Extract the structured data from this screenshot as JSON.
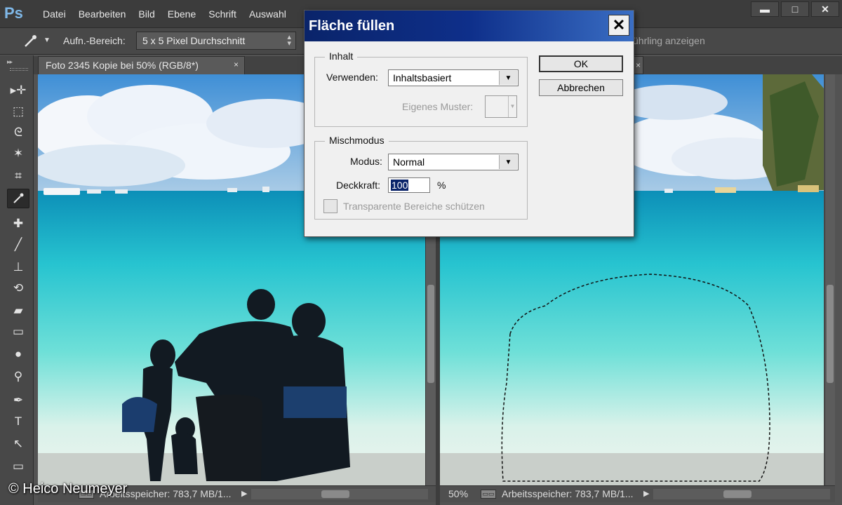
{
  "app": {
    "logo": "Ps"
  },
  "menu": [
    "Datei",
    "Bearbeiten",
    "Bild",
    "Ebene",
    "Schrift",
    "Auswahl"
  ],
  "window_controls": {
    "minimize": "▬",
    "maximize": "□",
    "close": "✕"
  },
  "options_bar": {
    "sample_label": "Aufn.-Bereich:",
    "sample_value": "5 x 5 Pixel Durchschnitt",
    "sample_ring_text": "ührling anzeigen"
  },
  "tools": [
    {
      "name": "move-tool-icon",
      "glyph": "▸✛"
    },
    {
      "name": "marquee-tool-icon",
      "glyph": "⬚"
    },
    {
      "name": "lasso-tool-icon",
      "glyph": "ᘓ"
    },
    {
      "name": "magic-wand-tool-icon",
      "glyph": "✶"
    },
    {
      "name": "crop-tool-icon",
      "glyph": "⌗"
    },
    {
      "name": "eyedropper-tool-icon",
      "glyph": "⁄",
      "active": true
    },
    {
      "name": "healing-brush-tool-icon",
      "glyph": "✚"
    },
    {
      "name": "brush-tool-icon",
      "glyph": "╱"
    },
    {
      "name": "stamp-tool-icon",
      "glyph": "⊥"
    },
    {
      "name": "history-brush-tool-icon",
      "glyph": "⟲"
    },
    {
      "name": "eraser-tool-icon",
      "glyph": "▰"
    },
    {
      "name": "gradient-tool-icon",
      "glyph": "▭"
    },
    {
      "name": "blur-tool-icon",
      "glyph": "●"
    },
    {
      "name": "dodge-tool-icon",
      "glyph": "⚲"
    },
    {
      "name": "pen-tool-icon",
      "glyph": "✒"
    },
    {
      "name": "type-tool-icon",
      "glyph": "T"
    },
    {
      "name": "path-select-tool-icon",
      "glyph": "↖"
    },
    {
      "name": "shape-tool-icon",
      "glyph": "▭"
    }
  ],
  "document": {
    "tab_title": "Foto 2345 Kopie bei 50% (RGB/8*)",
    "tab_close": "×",
    "tab2_close": "×"
  },
  "status_left": {
    "mem": "Arbeitsspeicher: 783,7 MB/1...",
    "arrow": "▶"
  },
  "status_right": {
    "zoom": "50%",
    "mem": "Arbeitsspeicher: 783,7 MB/1...",
    "arrow": "▶"
  },
  "copyright": "© Heico Neumeyer",
  "dialog": {
    "title": "Fläche füllen",
    "close": "✕",
    "content_group": "Inhalt",
    "use_label": "Verwenden:",
    "use_value": "Inhaltsbasiert",
    "custom_pattern_label": "Eigenes Muster:",
    "blend_group": "Mischmodus",
    "mode_label": "Modus:",
    "mode_value": "Normal",
    "opacity_label": "Deckkraft:",
    "opacity_value": "100",
    "opacity_unit": "%",
    "preserve_transparency_label": "Transparente Bereiche schützen",
    "preserve_transparency_checked": false,
    "ok": "OK",
    "cancel": "Abbrechen"
  },
  "colors": {
    "titlebar": "#0a246a",
    "ui_dark": "#535353",
    "sea": "#2ad0d6",
    "sky": "#4a9ad8"
  }
}
